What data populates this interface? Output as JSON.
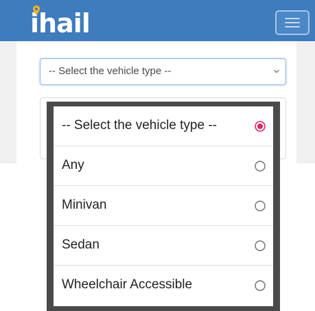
{
  "app": {
    "logo_text": "ihail"
  },
  "colors": {
    "navbar": "#3e7cbd",
    "accent_radio": "#e0245e",
    "radio_unselected": "#6d6d6d"
  },
  "form": {
    "vehicle_select_value": "-- Select the vehicle type --"
  },
  "picker": {
    "options": [
      {
        "label": "-- Select the vehicle type --",
        "selected": true
      },
      {
        "label": "Any",
        "selected": false
      },
      {
        "label": "Minivan",
        "selected": false
      },
      {
        "label": "Sedan",
        "selected": false
      },
      {
        "label": "Wheelchair Accessible",
        "selected": false
      }
    ]
  }
}
